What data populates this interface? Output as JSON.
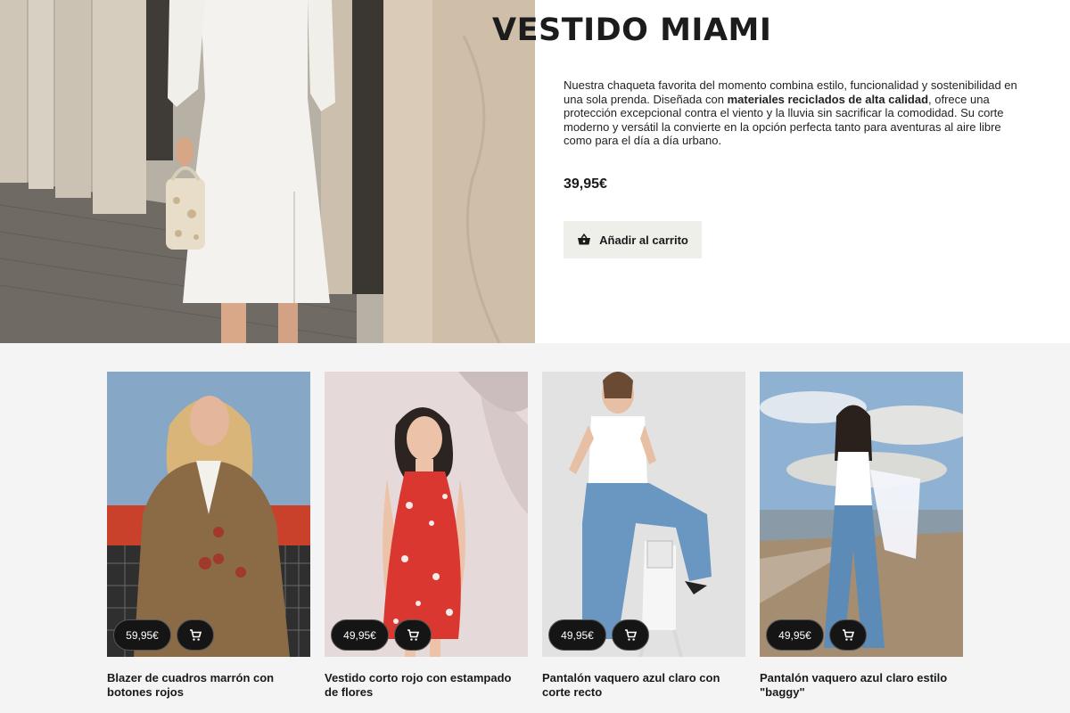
{
  "hero": {
    "title": "VESTIDO MIAMI",
    "description_before": "Nuestra chaqueta favorita del momento combina estilo, funcionalidad y sostenibilidad en una sola prenda. Diseñada con ",
    "description_bold": "materiales reciclados de alta calidad",
    "description_after": ", ofrece una protección excepcional contra el viento y la lluvia sin sacrificar la comodidad. Su corte moderno y versátil la convierte en la opción perfecta tanto para aventuras al aire libre como para el día a día urbano.",
    "price": "39,95€",
    "add_to_cart_label": "Añadir al carrito",
    "add_to_cart_icon": "shopping-basket-icon"
  },
  "products": [
    {
      "title": "Blazer de cuadros marrón con botones rojos",
      "price": "59,95€",
      "cart_icon": "shopping-cart-icon"
    },
    {
      "title": "Vestido corto rojo con estampado de flores",
      "price": "49,95€",
      "cart_icon": "shopping-cart-icon"
    },
    {
      "title": "Pantalón vaquero azul claro con corte recto",
      "price": "49,95€",
      "cart_icon": "shopping-cart-icon"
    },
    {
      "title": "Pantalón vaquero azul claro estilo \"baggy\"",
      "price": "49,95€",
      "cart_icon": "shopping-cart-icon"
    }
  ],
  "colors": {
    "page_background": "#ffffff",
    "products_background": "#f4f4f4",
    "button_background": "#efefe9",
    "pill_background": "#151515"
  }
}
